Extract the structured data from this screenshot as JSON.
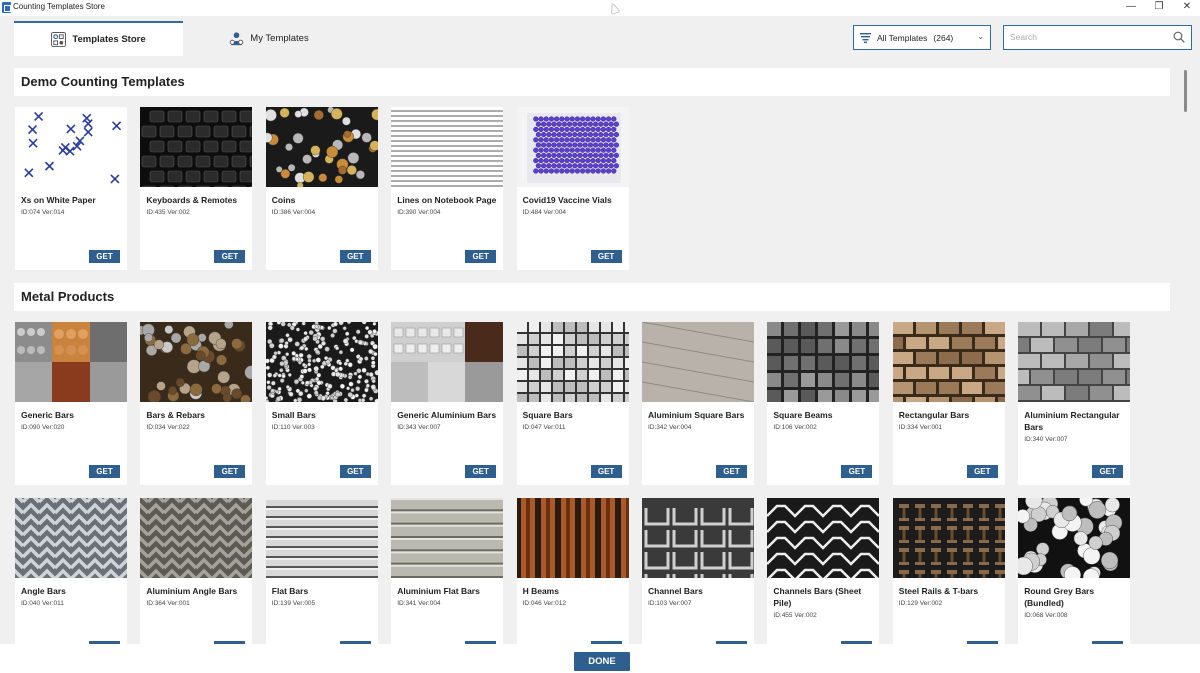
{
  "window": {
    "title": "Counting Templates Store",
    "minimize": "—",
    "restore": "❐",
    "close": "✕"
  },
  "tabs": {
    "store": {
      "label": "Templates Store",
      "icon": "store-icon"
    },
    "mine": {
      "label": "My Templates",
      "icon": "user-gears-icon"
    }
  },
  "filter": {
    "label": "All Templates",
    "count": "(264)",
    "icon": "filter-list-icon"
  },
  "search": {
    "placeholder": "Search",
    "icon": "search-icon"
  },
  "sections": [
    {
      "title": "Demo Counting Templates",
      "cards": [
        {
          "name": "Xs on White Paper",
          "meta": "ID:074 Ver:014",
          "thumb": "xs-paper"
        },
        {
          "name": "Keyboards & Remotes",
          "meta": "ID:435 Ver:002",
          "thumb": "keyboard"
        },
        {
          "name": "Coins",
          "meta": "ID:386 Ver:004",
          "thumb": "coins"
        },
        {
          "name": "Lines on Notebook Page",
          "meta": "ID:390 Ver:004",
          "thumb": "lines"
        },
        {
          "name": "Covid19 Vaccine Vials",
          "meta": "ID:484 Ver:004",
          "thumb": "vials"
        }
      ]
    },
    {
      "title": "Metal Products",
      "cards": [
        {
          "name": "Generic Bars",
          "meta": "ID:090 Ver:020",
          "thumb": "generic-bars"
        },
        {
          "name": "Bars & Rebars",
          "meta": "ID:034 Ver:022",
          "thumb": "rebars"
        },
        {
          "name": "Small Bars",
          "meta": "ID:110 Ver:003",
          "thumb": "small-bars"
        },
        {
          "name": "Generic Aluminium Bars",
          "meta": "ID:343 Ver:007",
          "thumb": "alu-generic"
        },
        {
          "name": "Square Bars",
          "meta": "ID:047 Ver:011",
          "thumb": "square-bars"
        },
        {
          "name": "Aluminium Square Bars",
          "meta": "ID:342 Ver:004",
          "thumb": "alu-square"
        },
        {
          "name": "Square Beams",
          "meta": "ID:106 Ver:002",
          "thumb": "square-beams"
        },
        {
          "name": "Rectangular Bars",
          "meta": "ID:334 Ver:001",
          "thumb": "rect-bars"
        },
        {
          "name": "Aluminium Rectangular Bars",
          "meta": "ID:340 Ver:007",
          "thumb": "alu-rect"
        },
        {
          "name": "Angle Bars",
          "meta": "ID:040 Ver:011",
          "thumb": "angle-bars"
        },
        {
          "name": "Aluminium Angle Bars",
          "meta": "ID:364 Ver:001",
          "thumb": "alu-angle"
        },
        {
          "name": "Flat Bars",
          "meta": "ID:139 Ver:005",
          "thumb": "flat-bars"
        },
        {
          "name": "Aluminium Flat Bars",
          "meta": "ID:341 Ver:004",
          "thumb": "alu-flat"
        },
        {
          "name": "H Beams",
          "meta": "ID:046 Ver:012",
          "thumb": "h-beams"
        },
        {
          "name": "Channel Bars",
          "meta": "ID:103 Ver:007",
          "thumb": "channel-bars"
        },
        {
          "name": "Channels Bars (Sheet Pile)",
          "meta": "ID:455 Ver:002",
          "thumb": "sheet-pile"
        },
        {
          "name": "Steel Rails & T-bars",
          "meta": "ID:129 Ver:002",
          "thumb": "rails"
        },
        {
          "name": "Round Grey Bars (Bundled)",
          "meta": "ID:068 Ver:008",
          "thumb": "round-grey"
        }
      ]
    }
  ],
  "get_label": "GET",
  "done_label": "DONE",
  "colors": {
    "accent": "#2e5f8f",
    "border": "#2e6da4",
    "background": "#f0f0f0"
  }
}
